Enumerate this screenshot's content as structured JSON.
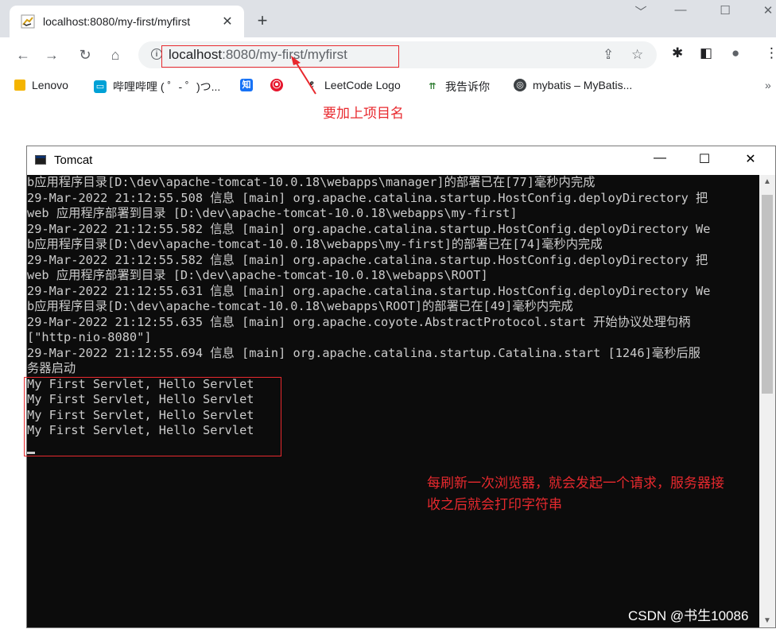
{
  "browser": {
    "tab": {
      "title": "localhost:8080/my-first/myfirst",
      "close_icon": "✕"
    },
    "new_tab_icon": "+",
    "window_controls": {
      "dropdown": "﹀",
      "minimize": "—",
      "maximize": "☐",
      "close": "✕"
    },
    "nav": {
      "back": "←",
      "forward": "→",
      "reload": "↻",
      "home": "⌂"
    },
    "address": {
      "host": "localhost",
      "rest": ":8080/my-first/myfirst"
    },
    "address_icons": {
      "share": "⇪",
      "star": "☆"
    },
    "toolbar_icons": {
      "extensions": "✱",
      "sidepanel": "◧",
      "profile": "●",
      "menu": "⋮"
    },
    "bookmarks": [
      {
        "label": "Lenovo",
        "icon": "folder-icon",
        "color": "#f4b400"
      },
      {
        "label": "哔哩哔哩 ( ゜- ゜)つ...",
        "icon": "bilibili-icon",
        "color": "#00a1d6"
      },
      {
        "label": "",
        "icon": "zhihu-icon",
        "color": "#1772f6",
        "glyph": "知"
      },
      {
        "label": "",
        "icon": "weibo-icon",
        "color": "#e6162d",
        "glyph": "⦿"
      },
      {
        "label": "LeetCode Logo",
        "icon": "leetcode-icon",
        "color": "#000000"
      },
      {
        "label": "我告诉你",
        "icon": "msdn-icon",
        "color": "#2e7d32"
      },
      {
        "label": "mybatis – MyBatis...",
        "icon": "globe-icon",
        "color": "#3c4043"
      }
    ],
    "bookmarks_overflow": "»"
  },
  "annotations": {
    "url_note": "要加上项目名",
    "output_note_line1": "每刷新一次浏览器，就会发起一个请求，服务器接",
    "output_note_line2": "收之后就会打印字符串",
    "color": "#e8292e"
  },
  "console": {
    "title": "Tomcat",
    "controls": {
      "minimize": "—",
      "maximize": "☐",
      "close": "✕"
    },
    "lines": [
      "b应用程序目录[D:\\dev\\apache-tomcat-10.0.18\\webapps\\manager]的部署已在[77]毫秒内完成",
      "29-Mar-2022 21:12:55.508 信息 [main] org.apache.catalina.startup.HostConfig.deployDirectory 把",
      "web 应用程序部署到目录 [D:\\dev\\apache-tomcat-10.0.18\\webapps\\my-first]",
      "29-Mar-2022 21:12:55.582 信息 [main] org.apache.catalina.startup.HostConfig.deployDirectory We",
      "b应用程序目录[D:\\dev\\apache-tomcat-10.0.18\\webapps\\my-first]的部署已在[74]毫秒内完成",
      "29-Mar-2022 21:12:55.582 信息 [main] org.apache.catalina.startup.HostConfig.deployDirectory 把",
      "web 应用程序部署到目录 [D:\\dev\\apache-tomcat-10.0.18\\webapps\\ROOT]",
      "29-Mar-2022 21:12:55.631 信息 [main] org.apache.catalina.startup.HostConfig.deployDirectory We",
      "b应用程序目录[D:\\dev\\apache-tomcat-10.0.18\\webapps\\ROOT]的部署已在[49]毫秒内完成",
      "29-Mar-2022 21:12:55.635 信息 [main] org.apache.coyote.AbstractProtocol.start 开始协议处理句柄",
      "[\"http-nio-8080\"]",
      "29-Mar-2022 21:12:55.694 信息 [main] org.apache.catalina.startup.Catalina.start [1246]毫秒后服",
      "务器启动",
      "My First Servlet, Hello Servlet",
      "My First Servlet, Hello Servlet",
      "My First Servlet, Hello Servlet",
      "My First Servlet, Hello Servlet"
    ]
  },
  "watermark": "CSDN @书生10086"
}
